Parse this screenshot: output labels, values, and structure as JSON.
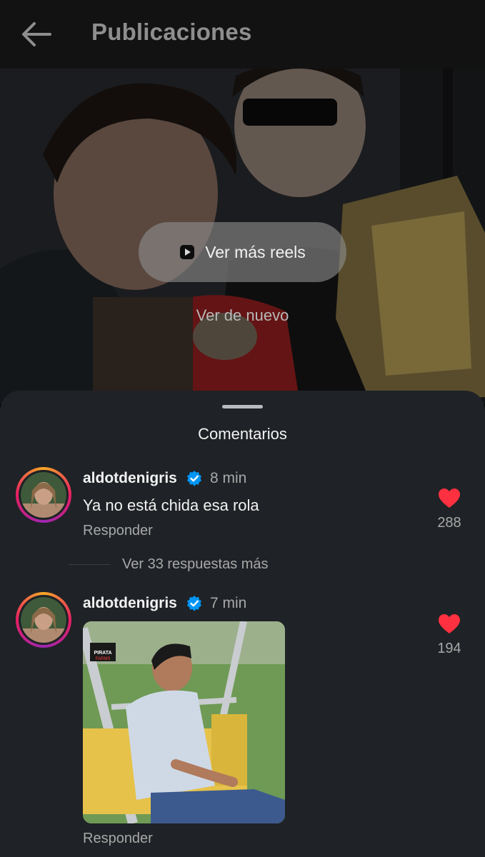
{
  "header": {
    "back_icon": "arrow-left-icon",
    "title": "Publicaciones"
  },
  "media": {
    "reels_button_label": "Ver más reels",
    "reels_icon": "play-square-icon",
    "replay_label": "Ver de nuevo"
  },
  "comments_sheet": {
    "title": "Comentarios",
    "comments": [
      {
        "username": "aldotdenigris",
        "verified": true,
        "time": "8 min",
        "text": "Ya no está chida esa rola",
        "reply_label": "Responder",
        "likes": "288"
      },
      {
        "username": "aldotdenigris",
        "verified": true,
        "time": "7 min",
        "gif_badge": "PIRATA FARMS",
        "reply_label": "Responder",
        "likes": "194"
      }
    ],
    "more_replies_label": "Ver 33 respuestas más"
  },
  "colors": {
    "background": "#1f2226",
    "topbar": "#121212",
    "heart": "#ff3040",
    "verified": "#0095f6"
  }
}
